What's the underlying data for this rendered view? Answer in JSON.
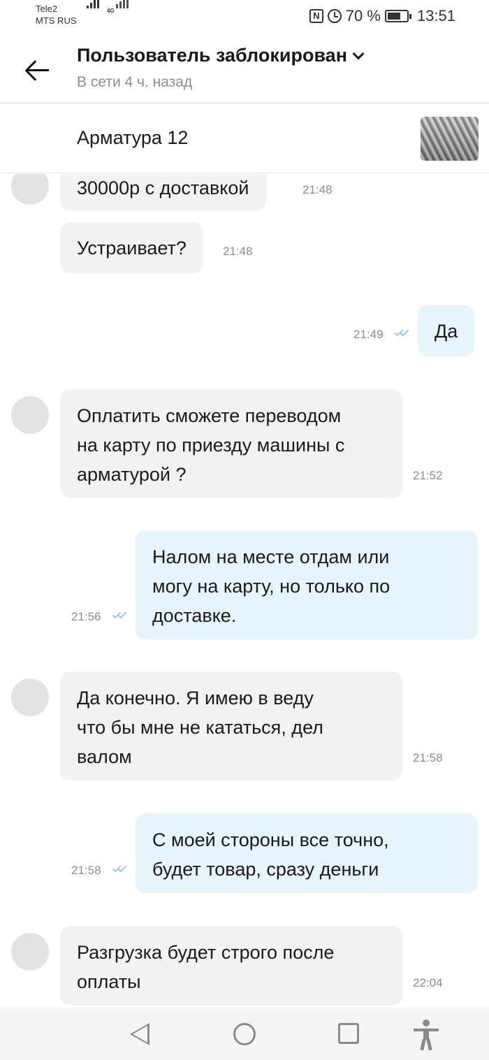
{
  "status_bar": {
    "carrier1": "Tele2",
    "carrier2": "MTS RUS",
    "network_type": "4G",
    "nfc_label": "N",
    "battery": "70 %",
    "battery_level": 0.7,
    "time": "13:51"
  },
  "header": {
    "title": "Пользователь заблокирован",
    "subtitle": "В сети 4 ч. назад"
  },
  "product": {
    "title": "Арматура 12"
  },
  "messages": [
    {
      "from": "them",
      "text": "30000р с доставкой",
      "time": "21:48"
    },
    {
      "from": "them",
      "text": "Устраивает?",
      "time": "21:48"
    },
    {
      "from": "me",
      "text": "Да",
      "time": "21:49",
      "read": true
    },
    {
      "from": "them",
      "text": "Оплатить сможете переводом\nна карту по приезду машины с\nарматурой ?",
      "time": "21:52"
    },
    {
      "from": "me",
      "text": "Налом на месте отдам или\nмогу на карту, но только по\nдоставке.",
      "time": "21:56",
      "read": true
    },
    {
      "from": "them",
      "text": "Да конечно. Я имею в веду\nчто бы мне не кататься, дел\nвалом",
      "time": "21:58"
    },
    {
      "from": "me",
      "text": "С моей стороны все точно,\nбудет товар, сразу деньги",
      "time": "21:58",
      "read": true
    },
    {
      "from": "them",
      "text": "Разгрузка будет строго  после\nоплаты",
      "time": "22:04"
    }
  ]
}
